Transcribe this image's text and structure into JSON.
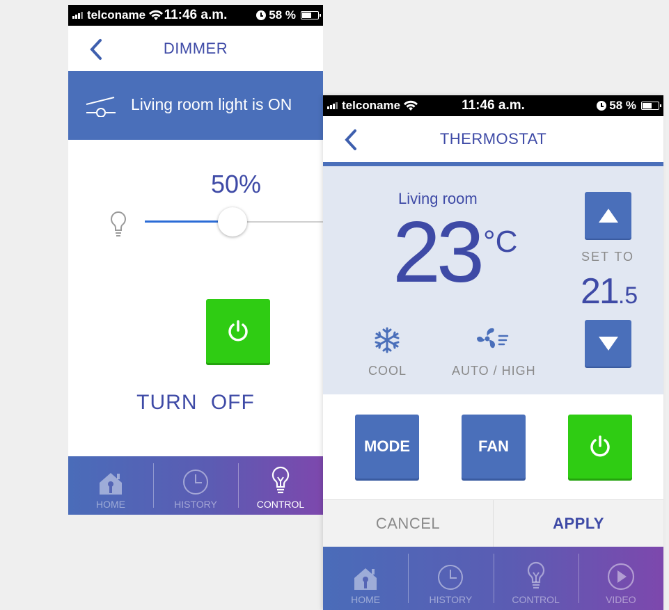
{
  "dimmer": {
    "status": {
      "carrier": "telconame",
      "time": "11:46 a.m.",
      "battery": "58 %"
    },
    "title": "DIMMER",
    "banner_text": "Living room light is ON",
    "brightness_label": "50%",
    "brightness_level": 0.5,
    "action_label": "TURN  OFF",
    "tabs": [
      {
        "label": "HOME",
        "icon": "home-icon"
      },
      {
        "label": "HISTORY",
        "icon": "clock-icon"
      },
      {
        "label": "CONTROL",
        "icon": "bulb-icon",
        "active": true
      }
    ]
  },
  "thermostat": {
    "status": {
      "carrier": "telconame",
      "time": "11:46 a.m.",
      "battery": "58 %"
    },
    "title": "THERMOSTAT",
    "room": "Living room",
    "current_temp": "23",
    "unit": "°C",
    "set_to_label": "SET TO",
    "set_value_int": "21",
    "set_value_dec": ".5",
    "mode_label": "COOL",
    "fan_label": "AUTO / HIGH",
    "buttons": {
      "mode": "MODE",
      "fan": "FAN"
    },
    "actions": {
      "cancel": "CANCEL",
      "apply": "APPLY"
    },
    "tabs": [
      {
        "label": "HOME",
        "icon": "home-icon"
      },
      {
        "label": "HISTORY",
        "icon": "clock-icon"
      },
      {
        "label": "CONTROL",
        "icon": "bulb-icon"
      },
      {
        "label": "VIDEO",
        "icon": "play-icon"
      }
    ]
  },
  "colors": {
    "accent_blue": "#4a6fba",
    "text_blue": "#3e4aa6",
    "power_green": "#2fcc13",
    "panel_bg": "#e1e7f2"
  }
}
